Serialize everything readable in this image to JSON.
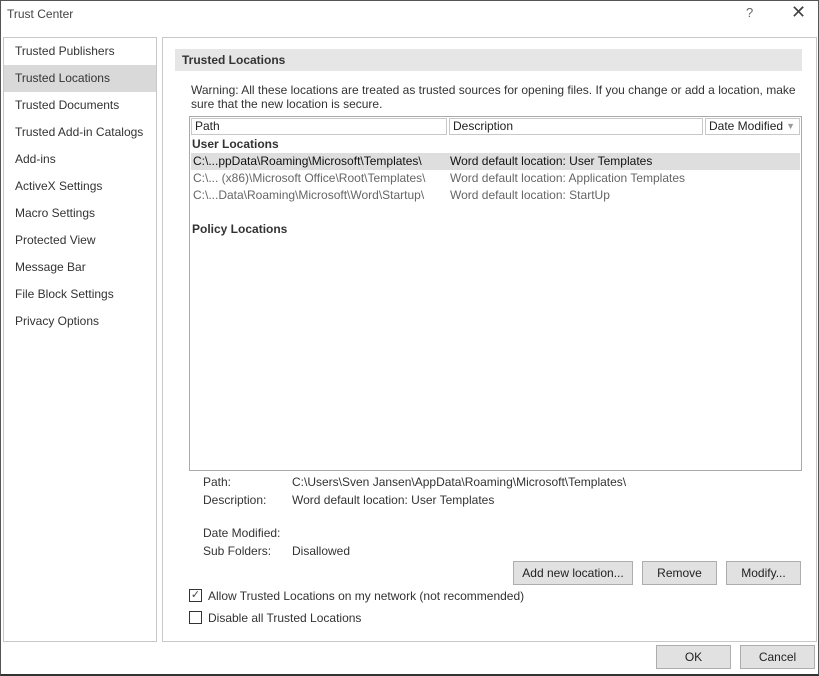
{
  "window": {
    "title": "Trust Center",
    "help": "?",
    "close": "✕"
  },
  "sidebar": {
    "items": [
      {
        "label": "Trusted Publishers"
      },
      {
        "label": "Trusted Locations",
        "selected": true
      },
      {
        "label": "Trusted Documents"
      },
      {
        "label": "Trusted Add-in Catalogs"
      },
      {
        "label": "Add-ins"
      },
      {
        "label": "ActiveX Settings"
      },
      {
        "label": "Macro Settings"
      },
      {
        "label": "Protected View"
      },
      {
        "label": "Message Bar"
      },
      {
        "label": "File Block Settings"
      },
      {
        "label": "Privacy Options"
      }
    ]
  },
  "main": {
    "header": "Trusted Locations",
    "warning": "Warning: All these locations are treated as trusted sources for opening files.  If you change or add a location, make sure that the new location is secure.",
    "table": {
      "columns": [
        "Path",
        "Description",
        "Date Modified"
      ],
      "user_group": "User Locations",
      "rows": [
        {
          "path": "C:\\...ppData\\Roaming\\Microsoft\\Templates\\",
          "description": "Word default location: User Templates"
        },
        {
          "path": "C:\\... (x86)\\Microsoft Office\\Root\\Templates\\",
          "description": "Word default location: Application Templates"
        },
        {
          "path": "C:\\...Data\\Roaming\\Microsoft\\Word\\Startup\\",
          "description": "Word default location: StartUp"
        }
      ],
      "policy_group": "Policy Locations"
    },
    "details": {
      "path_label": "Path:",
      "path": "C:\\Users\\Sven Jansen\\AppData\\Roaming\\Microsoft\\Templates\\",
      "description_label": "Description:",
      "description": "Word default location: User Templates",
      "date_label": "Date Modified:",
      "subfolders_label": "Sub Folders:",
      "subfolders": "Disallowed"
    },
    "buttons": {
      "add": "Add new location...",
      "remove": "Remove",
      "modify": "Modify..."
    },
    "allow_network": {
      "label": "Allow Trusted Locations on my network (not recommended)",
      "checked": true
    },
    "disable_all": {
      "label": "Disable all Trusted Locations",
      "checked": false
    }
  },
  "footer": {
    "ok": "OK",
    "cancel": "Cancel"
  }
}
